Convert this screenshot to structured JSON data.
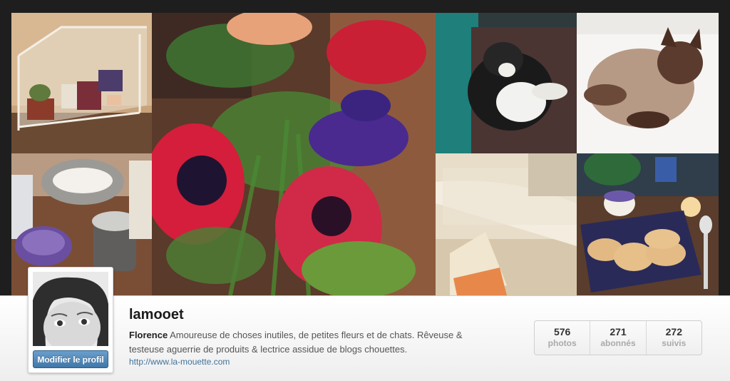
{
  "cover": {
    "photos": [
      "greenhouse-photo",
      "flowers-photo",
      "cat-on-chair-photo",
      "siamese-cat-photo",
      "kitchen-bowls-photo",
      "bathtub-book-photo",
      "breakfast-tray-photo"
    ]
  },
  "profile": {
    "username": "lamooet",
    "full_name": "Florence",
    "bio": " Amoureuse de choses inutiles, de petites fleurs et de chats. Rêveuse & testeuse aguerrie de produits & lectrice assidue de blogs chouettes.",
    "website": "http://www.la-mouette.com",
    "edit_label": "Modifier le profil"
  },
  "stats": {
    "photos": {
      "value": "576",
      "label": "photos"
    },
    "followers": {
      "value": "271",
      "label": "abonnés"
    },
    "following": {
      "value": "272",
      "label": "suivis"
    }
  },
  "colors": {
    "link": "#3f729b",
    "button": "#4f86b8",
    "flower_red": "#d41e3c",
    "flower_purple": "#4a2a8e"
  }
}
